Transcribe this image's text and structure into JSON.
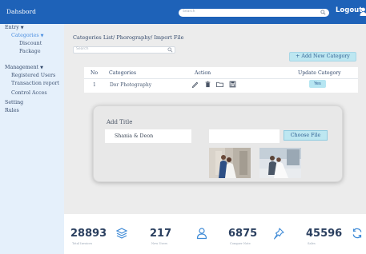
{
  "header": {
    "brand": "Dahsbord",
    "search_placeholder": "Search",
    "logout_label": "Logout"
  },
  "sidebar": {
    "entry": "Entry",
    "categories": "Categories",
    "discount": "Discount",
    "package": "Package",
    "management": "Management",
    "registered_users": "Registered Users",
    "transaction_report": "Transaction report",
    "control_access": "Control Acces",
    "setting": "Setting",
    "rules": "Rules"
  },
  "main": {
    "breadcrumb": "Categories List/ Phorography/ Import File",
    "filter_placeholder": "Search",
    "add_button": "+ Add New Category",
    "table": {
      "headers": [
        "No",
        "Categories",
        "Action",
        "Update Category"
      ],
      "rows": [
        {
          "no": "1",
          "category": "Dor Photography",
          "update": "Yes"
        }
      ]
    },
    "modal": {
      "title_label": "Add Title",
      "title_value": "Shania & Deon",
      "choose_file": "Choose File"
    }
  },
  "stats": [
    {
      "value": "28893",
      "label": "Total Invoices",
      "icon": "stack-icon"
    },
    {
      "value": "217",
      "label": "New Users",
      "icon": "users-icon"
    },
    {
      "value": "6875",
      "label": "Conquer Note",
      "icon": "pin-icon"
    },
    {
      "value": "45596",
      "label": "Sales",
      "icon": "refresh-icon"
    }
  ],
  "colors": {
    "header": "#1e62b8",
    "sidebar": "#e5f0fb",
    "accent_button": "#bde7f1",
    "content_bg": "#ececec"
  }
}
